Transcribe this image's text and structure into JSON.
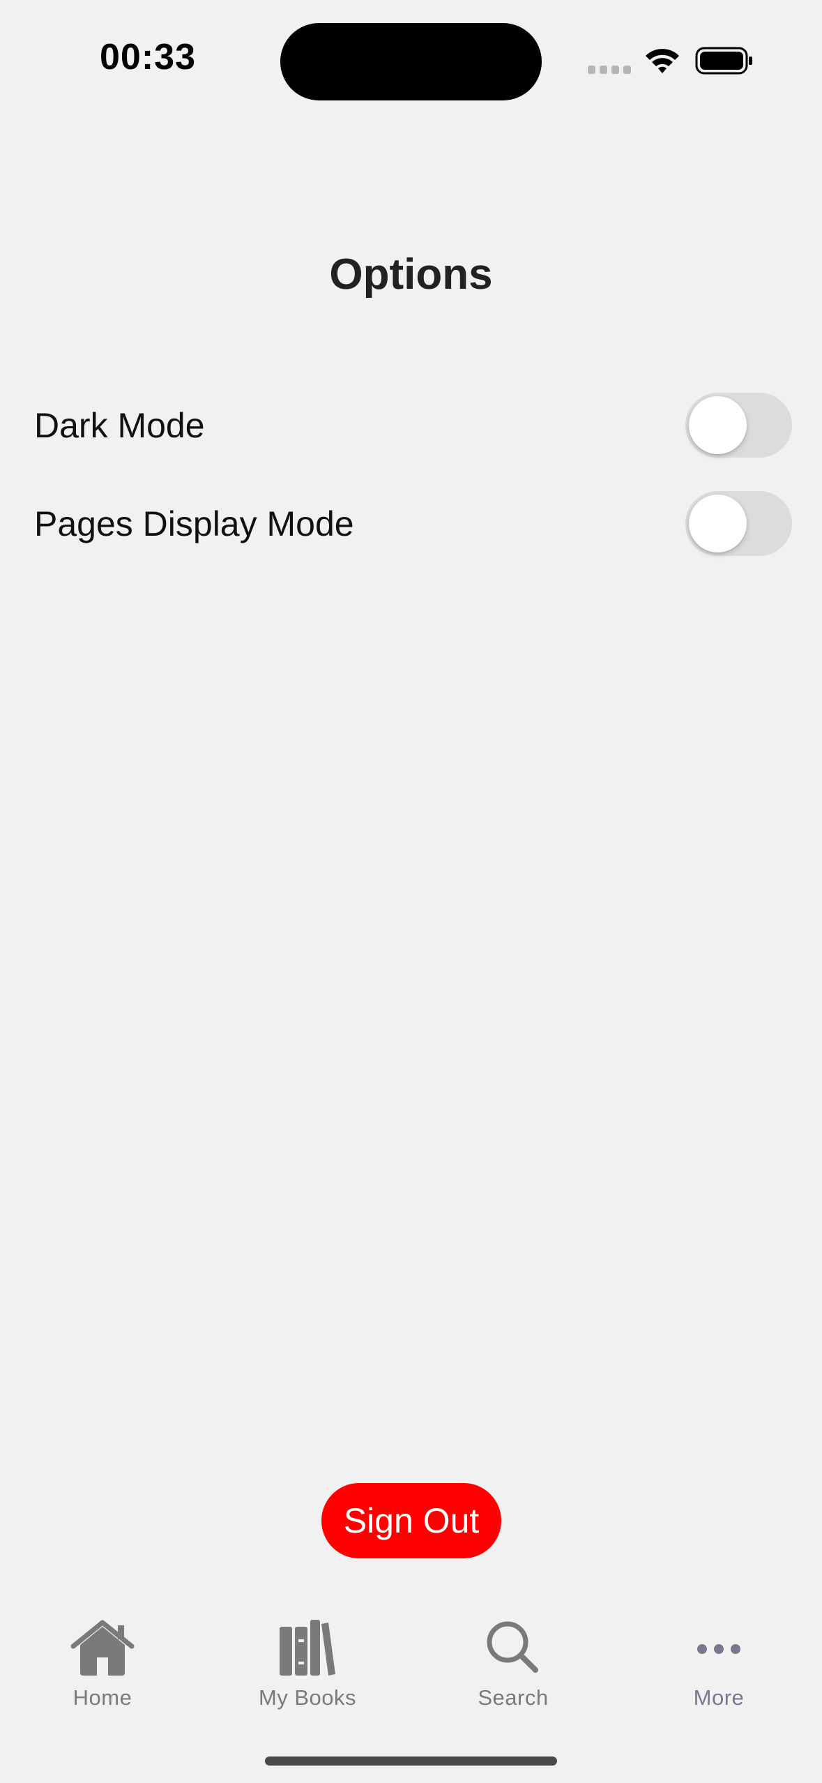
{
  "status_bar": {
    "time": "00:33"
  },
  "page": {
    "title": "Options"
  },
  "options": [
    {
      "label": "Dark Mode",
      "enabled": false
    },
    {
      "label": "Pages Display Mode",
      "enabled": false
    }
  ],
  "actions": {
    "sign_out_label": "Sign Out"
  },
  "tab_bar": {
    "tabs": [
      {
        "label": "Home",
        "icon": "home-icon"
      },
      {
        "label": "My Books",
        "icon": "books-icon"
      },
      {
        "label": "Search",
        "icon": "search-icon"
      },
      {
        "label": "More",
        "icon": "more-icon"
      }
    ],
    "active": "More"
  },
  "colors": {
    "background": "#f1f1f1",
    "sign_out": "#fe0000",
    "toggle_off": "#dcdcdc",
    "tab_inactive": "#7a7a7a",
    "tab_active": "#7e7590"
  }
}
